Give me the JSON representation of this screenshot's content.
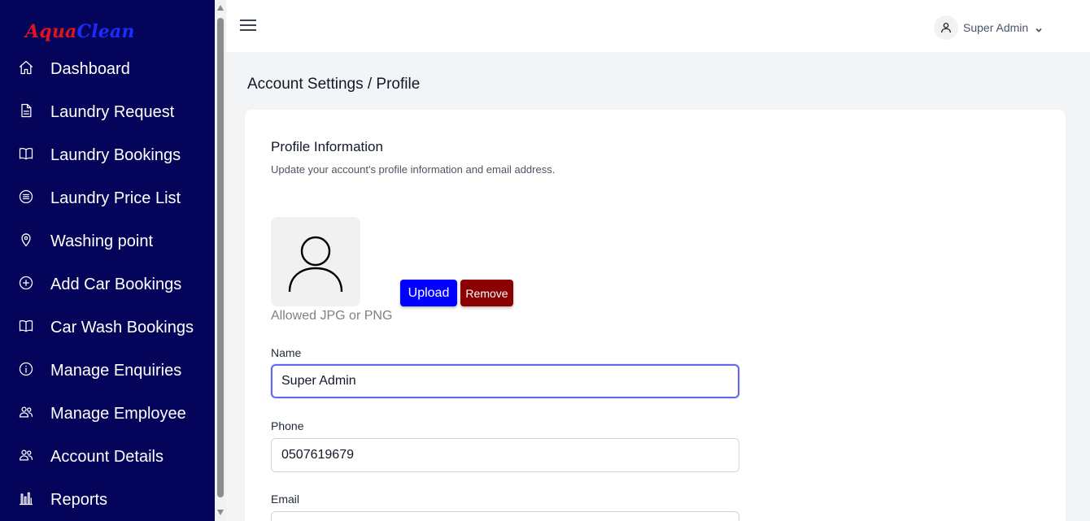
{
  "brand": {
    "part1": "Aqua",
    "part2": "Clean"
  },
  "sidebar": {
    "items": [
      {
        "label": "Dashboard",
        "icon": "home-icon"
      },
      {
        "label": "Laundry Request",
        "icon": "document-icon"
      },
      {
        "label": "Laundry Bookings",
        "icon": "book-icon"
      },
      {
        "label": "Laundry Price List",
        "icon": "list-circle-icon"
      },
      {
        "label": "Washing point",
        "icon": "map-pin-icon"
      },
      {
        "label": "Add Car Bookings",
        "icon": "plus-circle-icon"
      },
      {
        "label": "Car Wash Bookings",
        "icon": "book-icon"
      },
      {
        "label": "Manage Enquiries",
        "icon": "info-circle-icon"
      },
      {
        "label": "Manage Employee",
        "icon": "users-icon"
      },
      {
        "label": "Account Details",
        "icon": "users-icon"
      },
      {
        "label": "Reports",
        "icon": "bar-chart-icon"
      }
    ]
  },
  "header": {
    "user_name": "Super Admin"
  },
  "page": {
    "title": "Account Settings / Profile"
  },
  "profile": {
    "title": "Profile Information",
    "subtitle": "Update your account's profile information and email address.",
    "upload_label": "Upload",
    "remove_label": "Remove",
    "allowed_text": "Allowed JPG or PNG",
    "name_label": "Name",
    "name_value": "Super Admin",
    "phone_label": "Phone",
    "phone_value": "0507619679",
    "email_label": "Email",
    "email_value": ""
  },
  "colors": {
    "sidebar_bg": "#04045a",
    "upload_button": "#0000ff",
    "remove_button": "#8b0000",
    "focus_ring": "#6366f1"
  }
}
